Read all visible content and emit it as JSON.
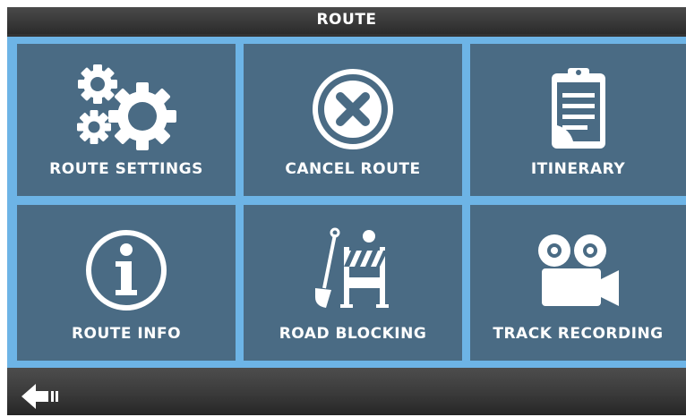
{
  "header": {
    "title": "ROUTE"
  },
  "menu": {
    "items": [
      {
        "label": "ROUTE SETTINGS",
        "icon": "gears-icon"
      },
      {
        "label": "CANCEL ROUTE",
        "icon": "cancel-x-icon"
      },
      {
        "label": "ITINERARY",
        "icon": "clipboard-icon"
      },
      {
        "label": "ROUTE INFO",
        "icon": "info-icon"
      },
      {
        "label": "ROAD BLOCKING",
        "icon": "road-block-icon"
      },
      {
        "label": "TRACK RECORDING",
        "icon": "video-camera-icon"
      }
    ]
  },
  "footer": {
    "back_icon": "back-arrow-icon"
  },
  "colors": {
    "tile": "#4a6b84",
    "grid_background": "#6db4e6",
    "title_bar": "#2b2b2b",
    "text": "#ffffff"
  }
}
